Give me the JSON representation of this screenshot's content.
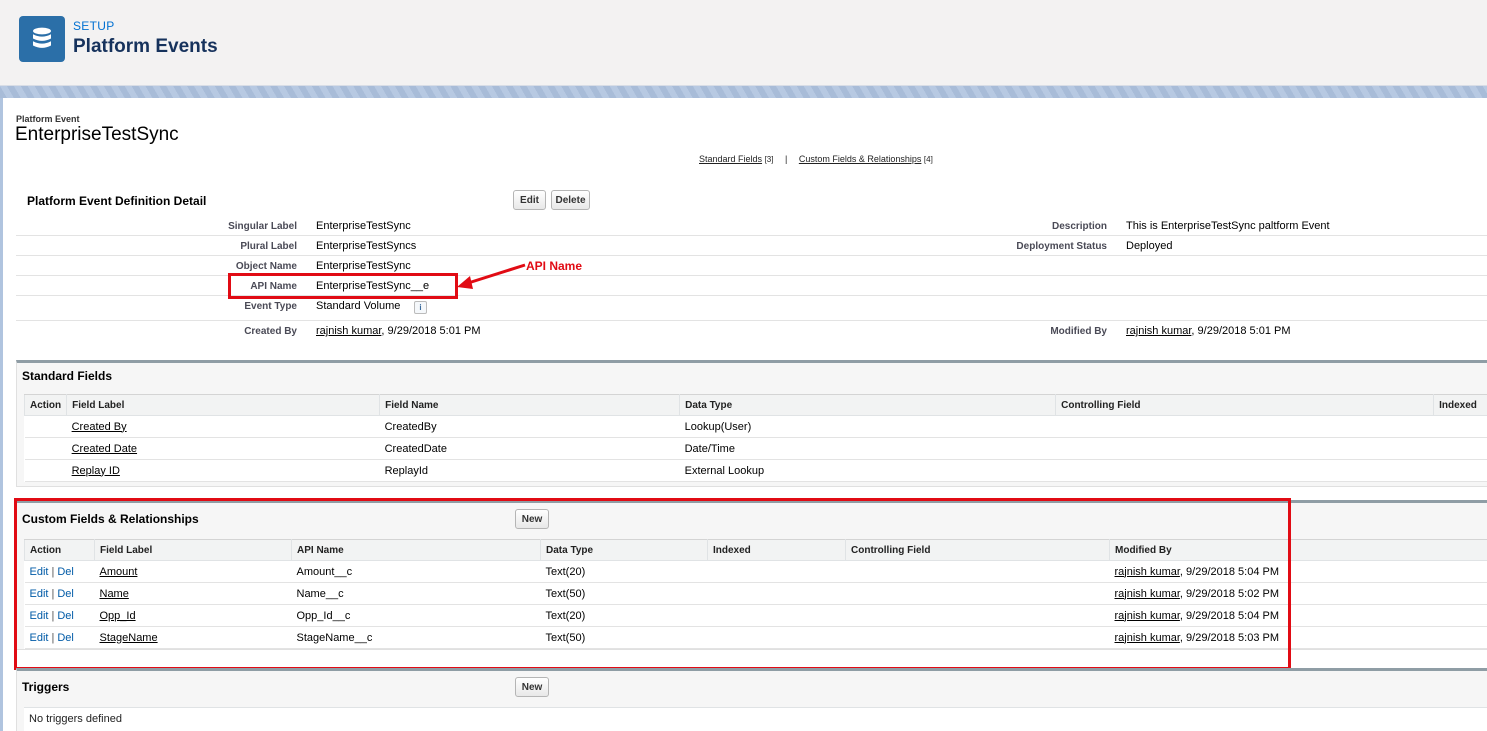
{
  "header": {
    "kicker": "SETUP",
    "title": "Platform Events"
  },
  "object": {
    "kicker": "Platform Event",
    "title": "EnterpriseTestSync"
  },
  "related_links": {
    "standard_fields": "Standard Fields",
    "standard_fields_count": "[3]",
    "separator": "|",
    "custom_fields": "Custom Fields & Relationships",
    "custom_fields_count": "[4]"
  },
  "detail": {
    "title": "Platform Event Definition Detail",
    "edit_label": "Edit",
    "delete_label": "Delete",
    "singular_label": {
      "label": "Singular Label",
      "value": "EnterpriseTestSync"
    },
    "plural_label": {
      "label": "Plural Label",
      "value": "EnterpriseTestSyncs"
    },
    "object_name": {
      "label": "Object Name",
      "value": "EnterpriseTestSync"
    },
    "api_name": {
      "label": "API Name",
      "value": "EnterpriseTestSync__e"
    },
    "event_type": {
      "label": "Event Type",
      "value": "Standard Volume",
      "info": "i"
    },
    "created_by": {
      "label": "Created By",
      "user": "rajnish kumar",
      "date": ", 9/29/2018 5:01 PM"
    },
    "description": {
      "label": "Description",
      "value": "This is EnterpriseTestSync paltform Event"
    },
    "deployment_status": {
      "label": "Deployment Status",
      "value": "Deployed"
    },
    "modified_by": {
      "label": "Modified By",
      "user": "rajnish kumar",
      "date": ", 9/29/2018 5:01 PM"
    }
  },
  "annotation": {
    "label": "API Name",
    "color": "#e10b14"
  },
  "standard_fields": {
    "title": "Standard Fields",
    "columns": [
      "Action",
      "Field Label",
      "Field Name",
      "Data Type",
      "Controlling Field",
      "Indexed"
    ],
    "rows": [
      {
        "label": "Created By",
        "name": "CreatedBy",
        "type": "Lookup(User)"
      },
      {
        "label": "Created Date",
        "name": "CreatedDate",
        "type": "Date/Time"
      },
      {
        "label": "Replay ID",
        "name": "ReplayId",
        "type": "External Lookup"
      }
    ]
  },
  "custom_fields": {
    "title": "Custom Fields & Relationships",
    "new_label": "New",
    "columns": [
      "Action",
      "Field Label",
      "API Name",
      "Data Type",
      "Indexed",
      "Controlling Field",
      "Modified By"
    ],
    "edit": "Edit",
    "sep": "|",
    "del": "Del",
    "rows": [
      {
        "label": "Amount",
        "api": "Amount__c",
        "type": "Text(20)",
        "user": "rajnish kumar",
        "date": ", 9/29/2018 5:04 PM"
      },
      {
        "label": "Name",
        "api": "Name__c",
        "type": "Text(50)",
        "user": "rajnish kumar",
        "date": ", 9/29/2018 5:02 PM"
      },
      {
        "label": "Opp_Id",
        "api": "Opp_Id__c",
        "type": "Text(20)",
        "user": "rajnish kumar",
        "date": ", 9/29/2018 5:04 PM"
      },
      {
        "label": "StageName",
        "api": "StageName__c",
        "type": "Text(50)",
        "user": "rajnish kumar",
        "date": ", 9/29/2018 5:03 PM"
      }
    ]
  },
  "triggers": {
    "title": "Triggers",
    "new_label": "New",
    "empty": "No triggers defined"
  },
  "colors": {
    "accent": "#2b6fa8",
    "link_blue": "#015ba7",
    "annotation_red": "#e10b14"
  }
}
